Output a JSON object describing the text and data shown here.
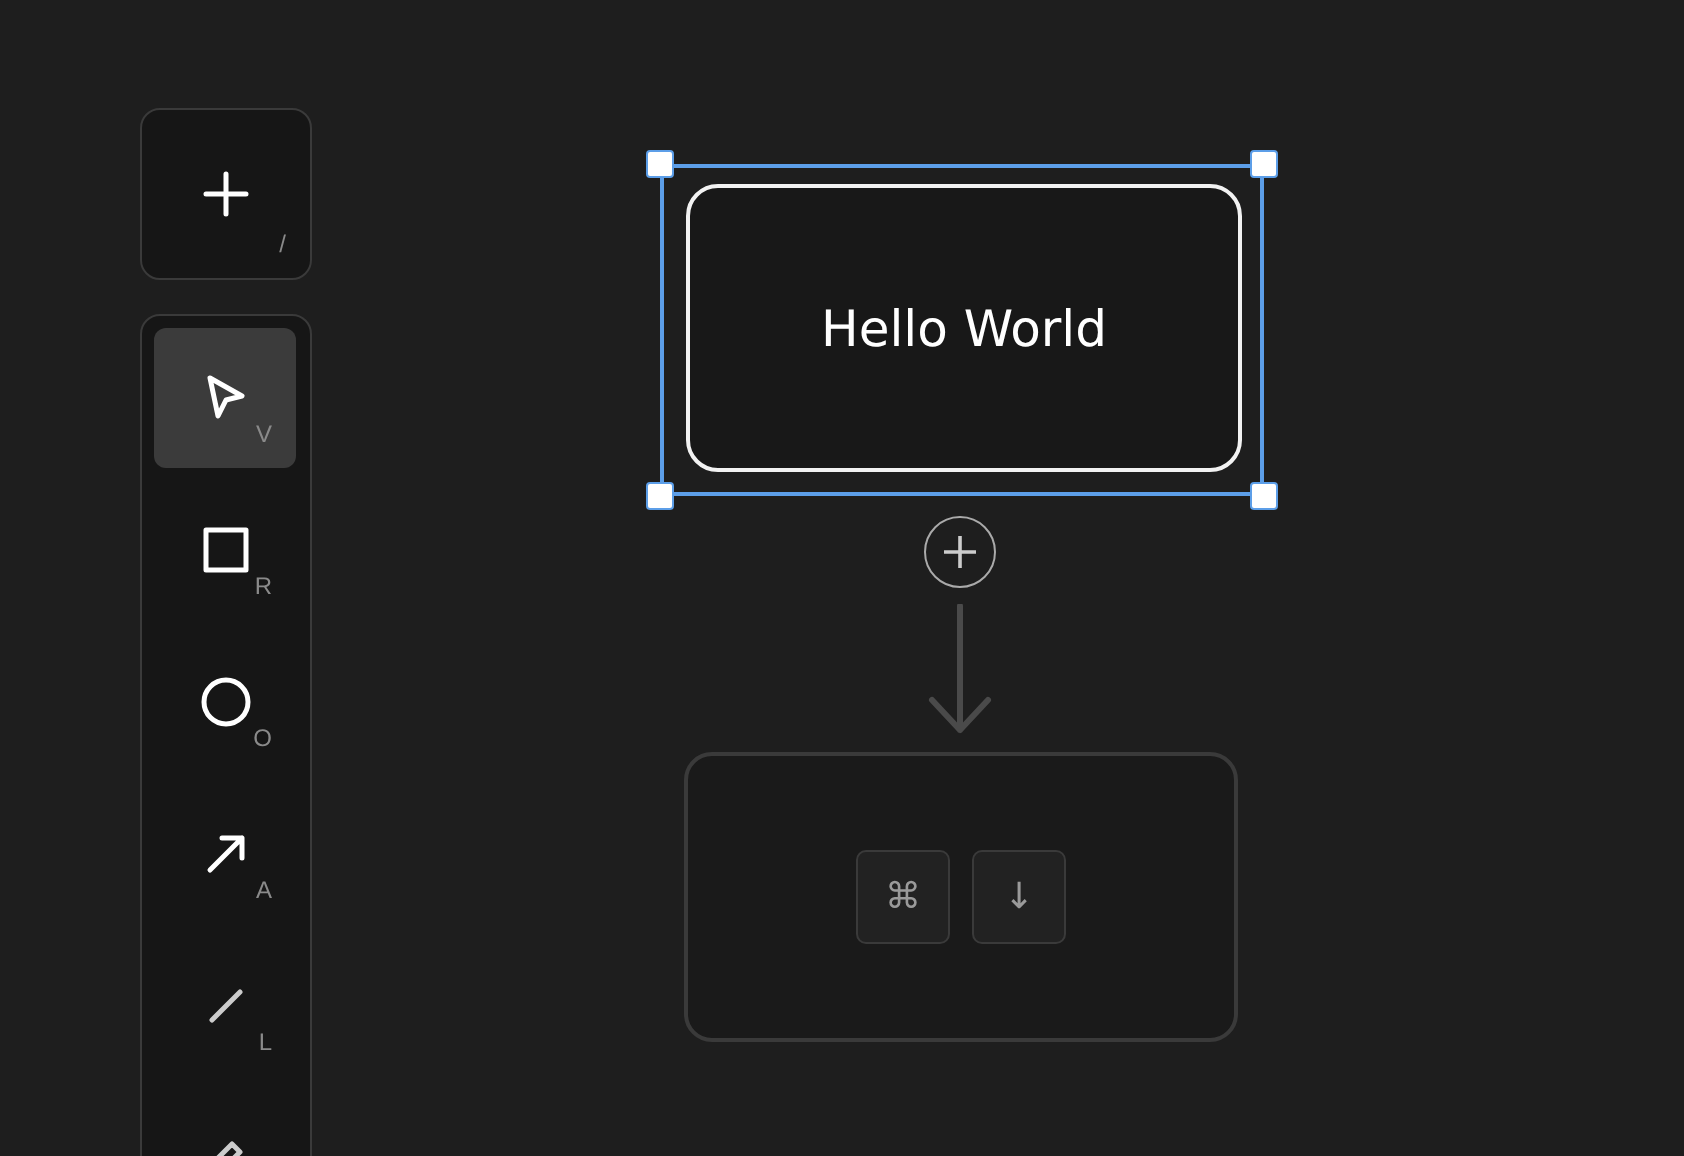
{
  "add_button": {
    "shortcut": "/"
  },
  "tools": [
    {
      "kind": "select",
      "shortcut": "V",
      "selected": true
    },
    {
      "kind": "rectangle",
      "shortcut": "R",
      "selected": false
    },
    {
      "kind": "ellipse",
      "shortcut": "O",
      "selected": false
    },
    {
      "kind": "arrow",
      "shortcut": "A",
      "selected": false
    },
    {
      "kind": "line",
      "shortcut": "L",
      "selected": false
    },
    {
      "kind": "pencil",
      "selected": false
    }
  ],
  "canvas": {
    "node": {
      "text": "Hello World",
      "selected": true
    },
    "ghost_node": {
      "keys": [
        "⌘",
        "↓"
      ]
    }
  }
}
